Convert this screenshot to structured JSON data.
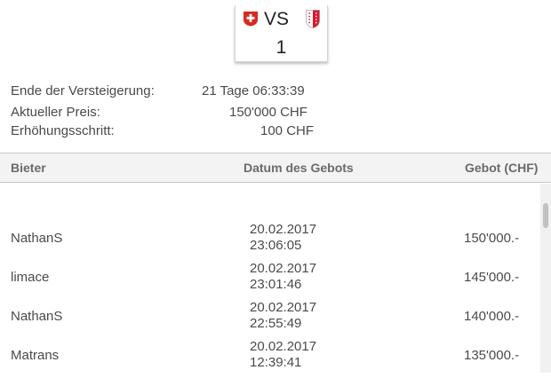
{
  "plate": {
    "canton_left_flag": "switzerland-flag-icon",
    "canton_code": "VS",
    "canton_right_flag": "valais-flag-icon",
    "number": "1"
  },
  "auction": {
    "end_label": "Ende der Versteigerung:",
    "end_value": "21 Tage 06:33:39",
    "price_label": "Aktueller Preis:",
    "price_value": "150'000 CHF",
    "increment_label": "Erhöhungsschritt:",
    "increment_value": "100 CHF"
  },
  "table": {
    "headers": [
      "Bieter",
      "Datum des Gebots",
      "Gebot (CHF)"
    ],
    "rows": [
      {
        "bidder": "NathanS",
        "date": "20.02.2017",
        "time": "23:06:05",
        "amount": "150'000.-"
      },
      {
        "bidder": "limace",
        "date": "20.02.2017",
        "time": "23:01:46",
        "amount": "145'000.-"
      },
      {
        "bidder": "NathanS",
        "date": "20.02.2017",
        "time": "22:55:49",
        "amount": "140'000.-"
      },
      {
        "bidder": "Matrans",
        "date": "20.02.2017",
        "time": "12:39:41",
        "amount": "135'000.-"
      }
    ]
  },
  "colors": {
    "swiss_red": "#d52b1e",
    "valais_red": "#e2142d",
    "header_bg": "#f3f3f3",
    "text": "#4a4a4a"
  }
}
